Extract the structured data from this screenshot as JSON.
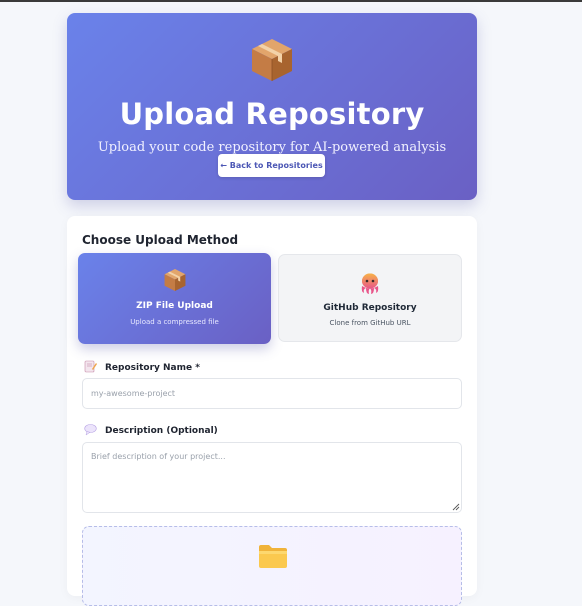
{
  "hero": {
    "title": "Upload Repository",
    "subtitle": "Upload your code repository for AI-powered analysis",
    "back_label": "← Back to Repositories",
    "icon": "package-box-icon"
  },
  "upload_method": {
    "section_title": "Choose Upload Method",
    "methods": [
      {
        "title": "ZIP File Upload",
        "description": "Upload a compressed file",
        "icon": "package-box-icon",
        "selected": true
      },
      {
        "title": "GitHub Repository",
        "description": "Clone from GitHub URL",
        "icon": "octopus-icon",
        "selected": false
      }
    ]
  },
  "form": {
    "repo_name": {
      "label": "Repository Name *",
      "placeholder": "my-awesome-project",
      "value": "",
      "icon": "memo-icon"
    },
    "description": {
      "label": "Description (Optional)",
      "placeholder": "Brief description of your project...",
      "value": "",
      "icon": "speech-bubble-icon"
    }
  },
  "dropzone": {
    "icon": "folder-icon"
  },
  "colors": {
    "accent_start": "#6a82ea",
    "accent_end": "#6a60c4",
    "page_bg": "#f5f7fb",
    "card_bg": "#ffffff"
  }
}
